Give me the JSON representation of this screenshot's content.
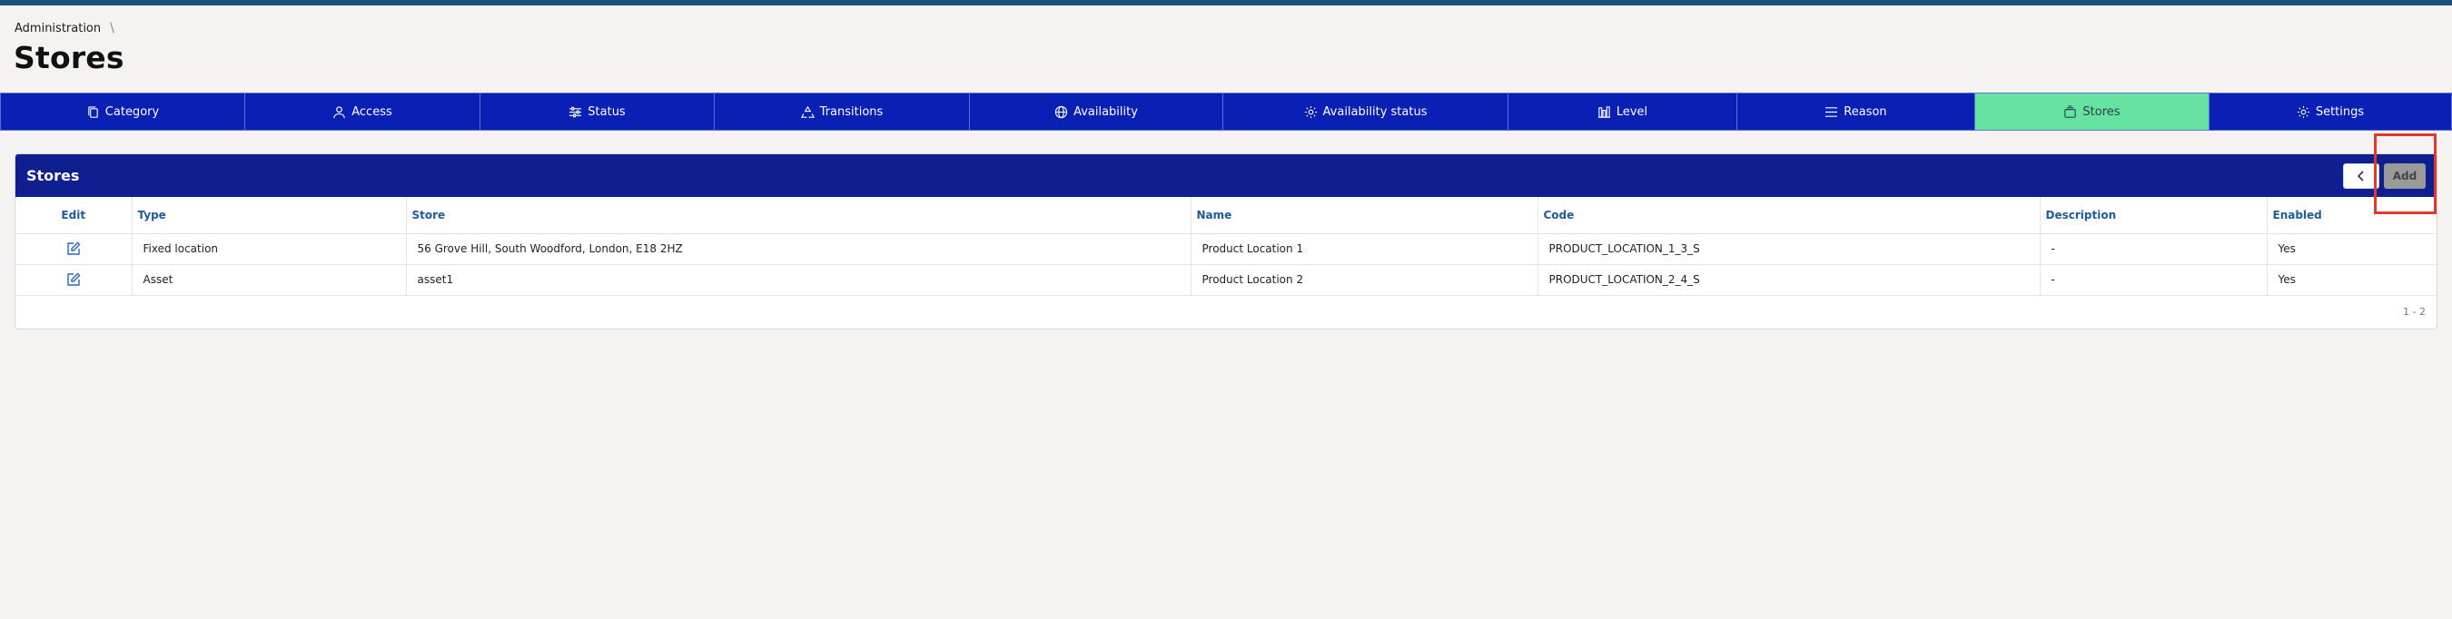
{
  "breadcrumb": {
    "item": "Administration",
    "separator": "\\"
  },
  "page": {
    "title": "Stores"
  },
  "tabs": [
    {
      "label": "Category",
      "icon": "copy-icon"
    },
    {
      "label": "Access",
      "icon": "user-icon"
    },
    {
      "label": "Status",
      "icon": "sliders-icon"
    },
    {
      "label": "Transitions",
      "icon": "recycle-icon"
    },
    {
      "label": "Availability",
      "icon": "globe-icon"
    },
    {
      "label": "Availability status",
      "icon": "gear-icon"
    },
    {
      "label": "Level",
      "icon": "level-bars-icon"
    },
    {
      "label": "Reason",
      "icon": "menu-lines-icon"
    },
    {
      "label": "Stores",
      "icon": "stack-icon",
      "active": true
    },
    {
      "label": "Settings",
      "icon": "gear-icon"
    }
  ],
  "card": {
    "title": "Stores",
    "add_label": "Add",
    "back_icon": "chevron-left-icon",
    "pagination": "1 - 2"
  },
  "table": {
    "headers": [
      "Edit",
      "Type",
      "Store",
      "Name",
      "Code",
      "Description",
      "Enabled"
    ],
    "rows": [
      {
        "type": "Fixed location",
        "store": "56 Grove Hill, South Woodford, London, E18 2HZ",
        "name": "Product Location 1",
        "code": "PRODUCT_LOCATION_1_3_S",
        "description": "-",
        "enabled": "Yes"
      },
      {
        "type": "Asset",
        "store": "asset1",
        "name": "Product Location 2",
        "code": "PRODUCT_LOCATION_2_4_S",
        "description": "-",
        "enabled": "Yes"
      }
    ]
  },
  "colors": {
    "tab_bar": "#0a1fb3",
    "active_tab": "#66e3a1",
    "card_header": "#0f1f8f",
    "highlight": "#e03a2a",
    "header_text": "#1f5a9a"
  }
}
